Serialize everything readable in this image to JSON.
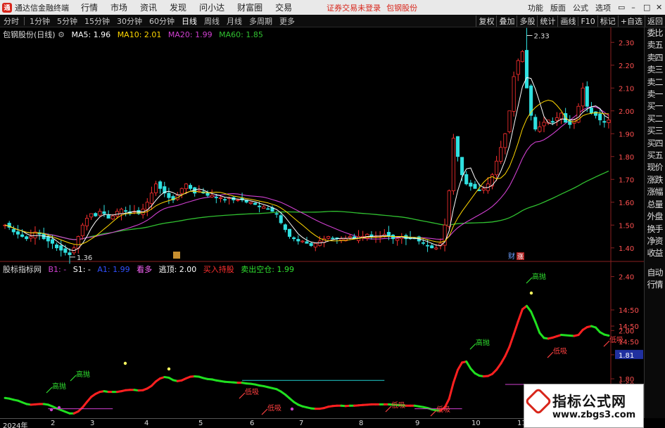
{
  "titlebar": {
    "app_name": "通达信金融终端",
    "menus": [
      "行情",
      "市场",
      "资讯",
      "发现",
      "问小达",
      "财富圈",
      "交易"
    ],
    "warning": "证券交易未登录",
    "stock_name": "包钢股份",
    "right_items": [
      "功能",
      "版面",
      "公式",
      "选项"
    ],
    "window_controls": [
      "▭",
      "–",
      "□",
      "✕"
    ]
  },
  "periodbar": {
    "periods": [
      "分时",
      "1分钟",
      "5分钟",
      "15分钟",
      "30分钟",
      "60分钟",
      "日线",
      "周线",
      "月线",
      "多周期",
      "更多"
    ],
    "active_period": "日线",
    "tools": [
      "复权",
      "叠加",
      "多股",
      "统计",
      "画线",
      "F10",
      "标记",
      "+自选",
      "返回"
    ]
  },
  "main_legend": {
    "title": "包钢股份(日线)",
    "ma": [
      {
        "label": "MA5: 1.96",
        "color": "#ffffff"
      },
      {
        "label": "MA10: 2.01",
        "color": "#ffd700"
      },
      {
        "label": "MA20: 1.99",
        "color": "#d040d0"
      },
      {
        "label": "MA60: 1.85",
        "color": "#30c030"
      }
    ]
  },
  "main_axis": {
    "ticks": [
      "2.30",
      "2.20",
      "2.10",
      "2.00",
      "1.90",
      "1.80",
      "1.70",
      "1.60",
      "1.50",
      "1.40"
    ],
    "high_label": "2.33",
    "low_label": "1.36",
    "badge": "财",
    "badge2": "涨",
    "low_marker": "□"
  },
  "indicator_legend": {
    "title": "股标指标网",
    "items": [
      {
        "label": "B1: -",
        "color": "#d040d0"
      },
      {
        "label": "S1: -",
        "color": "#ffffff"
      },
      {
        "label": "A1: 1.99",
        "color": "#3050ff"
      },
      {
        "label": "看多",
        "color": "#ff66ff"
      },
      {
        "label": "逃顶: 2.00",
        "color": "#ffffff"
      },
      {
        "label": "买入持股",
        "color": "#ff3030"
      },
      {
        "label": "卖出空仓: 1.99",
        "color": "#30e030"
      }
    ]
  },
  "indicator_axis": {
    "ticks": [
      "2.40",
      "14:50",
      "14:50",
      "14:50",
      "2.00",
      "1.81",
      "1.80",
      "14:50",
      "1.60"
    ],
    "current_value": "1.81"
  },
  "annotations": {
    "high_run": "高抛",
    "low_buy": "低吸",
    "tiny": "高抛"
  },
  "rightpanel": [
    "委比",
    "卖五",
    "卖四",
    "卖三",
    "卖二",
    "卖一",
    "买一",
    "买二",
    "买三",
    "买四",
    "买五",
    "现价",
    "涨跌",
    "涨幅",
    "总量",
    "外盘",
    "换手",
    "净资",
    "收益",
    "",
    "自动",
    "行情"
  ],
  "watermark": {
    "line1": "指标公式网",
    "line2": "www.zbgs3.com"
  },
  "date_axis": [
    "2024年",
    "2",
    "3",
    "4",
    "5",
    "6",
    "7",
    "8",
    "9",
    "10",
    "11"
  ],
  "colors": {
    "up": "#ff3030",
    "down": "#30e0e0",
    "ma60": "#30c030",
    "ma20": "#d040d0"
  },
  "chart_data": {
    "type": "candlestick",
    "price_range": [
      1.35,
      2.35
    ],
    "closes": [
      1.5,
      1.49,
      1.47,
      1.46,
      1.45,
      1.44,
      1.45,
      1.47,
      1.46,
      1.44,
      1.43,
      1.42,
      1.4,
      1.39,
      1.38,
      1.37,
      1.4,
      1.45,
      1.5,
      1.53,
      1.55,
      1.54,
      1.56,
      1.55,
      1.53,
      1.54,
      1.56,
      1.57,
      1.56,
      1.55,
      1.56,
      1.55,
      1.57,
      1.6,
      1.64,
      1.68,
      1.66,
      1.64,
      1.62,
      1.61,
      1.63,
      1.66,
      1.68,
      1.66,
      1.64,
      1.65,
      1.64,
      1.63,
      1.63,
      1.62,
      1.62,
      1.61,
      1.62,
      1.61,
      1.61,
      1.61,
      1.6,
      1.6,
      1.59,
      1.58,
      1.58,
      1.57,
      1.56,
      1.55,
      1.51,
      1.48,
      1.45,
      1.44,
      1.43,
      1.43,
      1.42,
      1.41,
      1.42,
      1.43,
      1.44,
      1.45,
      1.44,
      1.44,
      1.44,
      1.44,
      1.45,
      1.44,
      1.45,
      1.45,
      1.46,
      1.45,
      1.45,
      1.45,
      1.46,
      1.45,
      1.44,
      1.44,
      1.45,
      1.44,
      1.44,
      1.44,
      1.43,
      1.42,
      1.41,
      1.4,
      1.4,
      1.42,
      1.5,
      1.65,
      1.88,
      1.8,
      1.72,
      1.68,
      1.67,
      1.66,
      1.65,
      1.66,
      1.68,
      1.72,
      1.78,
      1.84,
      1.9,
      2.0,
      2.15,
      2.22,
      2.26,
      2.1,
      1.98,
      1.92,
      1.93,
      1.95,
      1.96,
      1.95,
      1.97,
      1.99,
      1.95,
      1.94,
      1.96,
      2.02,
      2.1,
      2.02,
      1.99,
      1.98,
      1.96,
      1.95,
      1.96
    ]
  }
}
